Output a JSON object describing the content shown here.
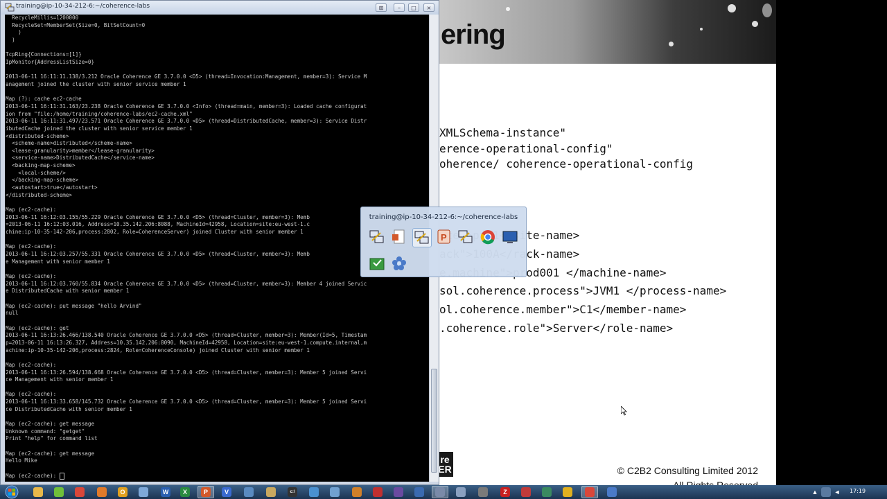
{
  "slide": {
    "title_fragment": "ering",
    "xml_lines": [
      "XMLSchema-instance\"",
      "erence-operational-config\"",
      "oherence/ coherence-operational-config",
      "ite\">pa-1</site-name>",
      "ack\">100A</rack-name>",
      "e.machine\">prod001 </machine-name>",
      "sol.coherence.process\">JVM1 </process-name>",
      "ol.coherence.member\">C1</member-name>",
      ".coherence.role\">Server</role-name>"
    ],
    "logo_text": "re\nER",
    "copyright_line1": "© C2B2 Consulting Limited 2012",
    "copyright_line2": "All Rights Reserved"
  },
  "putty": {
    "title": "training@ip-10-34-212-6:~/coherence-labs",
    "buttons": {
      "extra": "⊞",
      "minimize": "–",
      "maximize": "□",
      "close": "×"
    },
    "terminal_lines": [
      "  RecycleMillis=1200000",
      "  RecycleSet=MemberSet(Size=0, BitSetCount=0",
      "    )",
      "  )",
      "",
      "TcpRing{Connections=[1]}",
      "IpMonitor{AddressListSize=0}",
      "",
      "2013-06-11 16:11:11.138/3.212 Oracle Coherence GE 3.7.0.0 <D5> (thread=Invocation:Management, member=3): Service M",
      "anagement joined the cluster with senior service member 1",
      "",
      "Map (?): cache ec2-cache",
      "2013-06-11 16:11:31.163/23.238 Oracle Coherence GE 3.7.0.0 <Info> (thread=main, member=3): Loaded cache configurat",
      "ion from \"file:/home/training/coherence-labs/ec2-cache.xml\"",
      "2013-06-11 16:11:31.497/23.571 Oracle Coherence GE 3.7.0.0 <D5> (thread=DistributedCache, member=3): Service Distr",
      "ibutedCache joined the cluster with senior service member 1",
      "<distributed-scheme>",
      "  <scheme-name>distributed</scheme-name>",
      "  <lease-granularity>member</lease-granularity>",
      "  <service-name>DistributedCache</service-name>",
      "  <backing-map-scheme>",
      "    <local-scheme/>",
      "  </backing-map-scheme>",
      "  <autostart>true</autostart>",
      "</distributed-scheme>",
      "",
      "Map (ec2-cache):",
      "2013-06-11 16:12:03.155/55.229 Oracle Coherence GE 3.7.0.0 <D5> (thread=Cluster, member=3): Memb",
      "=2013-06-11 16:12:03.016, Address=10.35.142.206:8088, MachineId=42958, Location=site:eu-west-1.c",
      "chine:ip-10-35-142-206,process:2802, Role=CoherenceServer) joined Cluster with senior member 1",
      "",
      "Map (ec2-cache):",
      "2013-06-11 16:12:03.257/55.331 Oracle Coherence GE 3.7.0.0 <D5> (thread=Cluster, member=3): Memb",
      "e Management with senior member 1",
      "",
      "Map (ec2-cache):",
      "2013-06-11 16:12:03.760/55.834 Oracle Coherence GE 3.7.0.0 <D5> (thread=Cluster, member=3): Member 4 joined Servic",
      "e DistributedCache with senior member 1",
      "",
      "Map (ec2-cache): put message \"hello Arvind\"",
      "null",
      "",
      "Map (ec2-cache): get",
      "2013-06-11 16:13:26.466/138.540 Oracle Coherence GE 3.7.0.0 <D5> (thread=Cluster, member=3): Member(Id=5, Timestam",
      "p=2013-06-11 16:13:26.327, Address=10.35.142.206:8090, MachineId=42958, Location=site:eu-west-1.compute.internal,m",
      "achine:ip-10-35-142-206,process:2824, Role=CoherenceConsole) joined Cluster with senior member 1",
      "",
      "Map (ec2-cache):",
      "2013-06-11 16:13:26.594/138.668 Oracle Coherence GE 3.7.0.0 <D5> (thread=Cluster, member=3): Member 5 joined Servi",
      "ce Management with senior member 1",
      "",
      "Map (ec2-cache):",
      "2013-06-11 16:13:33.658/145.732 Oracle Coherence GE 3.7.0.0 <D5> (thread=Cluster, member=3): Member 5 joined Servi",
      "ce DistributedCache with senior member 1",
      "",
      "Map (ec2-cache): get message",
      "Unknown command: \"getget\"",
      "Print \"help\" for command list",
      "",
      "Map (ec2-cache): get message",
      "Hello Mike",
      "",
      "Map (ec2-cache): "
    ]
  },
  "popup": {
    "title": "training@ip-10-34-212-6:~/coherence-labs",
    "icons": [
      "putty-icon",
      "document-icon",
      "putty-icon",
      "powerpoint-icon",
      "putty-icon",
      "chrome-icon",
      "remote-desktop-icon",
      "download-icon",
      "flower-icon"
    ]
  },
  "taskbar": {
    "clock": "17:19",
    "icons": [
      {
        "name": "explorer-icon",
        "glyph": "",
        "color": "#e8b84a"
      },
      {
        "name": "green-app-icon",
        "glyph": "",
        "color": "#6fbf3a"
      },
      {
        "name": "chrome-icon",
        "glyph": "",
        "color": "#d9473a"
      },
      {
        "name": "firefox-icon",
        "glyph": "",
        "color": "#e07a2a"
      },
      {
        "name": "outlook-icon",
        "glyph": "O",
        "color": "#e0a020"
      },
      {
        "name": "notes-icon",
        "glyph": "",
        "color": "#7ea8d8"
      },
      {
        "name": "word-icon",
        "glyph": "W",
        "color": "#2a5fb0"
      },
      {
        "name": "excel-icon",
        "glyph": "X",
        "color": "#2a8a40"
      },
      {
        "name": "powerpoint-icon",
        "glyph": "P",
        "color": "#d2582a"
      },
      {
        "name": "visio-icon",
        "glyph": "V",
        "color": "#3a6ad0"
      },
      {
        "name": "network-icon",
        "glyph": "",
        "color": "#5a8ac0"
      },
      {
        "name": "folder-icon",
        "glyph": "",
        "color": "#c8a860"
      },
      {
        "name": "console-icon",
        "glyph": "c:\\",
        "color": "#333333"
      },
      {
        "name": "tool-icon",
        "glyph": "",
        "color": "#4a90d0"
      },
      {
        "name": "network2-icon",
        "glyph": "",
        "color": "#70a0d0"
      },
      {
        "name": "java-icon",
        "glyph": "",
        "color": "#d0802a"
      },
      {
        "name": "bug-icon",
        "glyph": "",
        "color": "#c03030"
      },
      {
        "name": "eclipse-icon",
        "glyph": "",
        "color": "#6a4aa0"
      },
      {
        "name": "shield-icon",
        "glyph": "",
        "color": "#3a6ab0"
      },
      {
        "name": "putty-icon",
        "glyph": "",
        "color": "#7a8aa8"
      },
      {
        "name": "arrow-icon",
        "glyph": "",
        "color": "#8aa0c0"
      },
      {
        "name": "tools-icon",
        "glyph": "",
        "color": "#7a7a7a"
      },
      {
        "name": "filezilla-icon",
        "glyph": "Z",
        "color": "#c82020"
      },
      {
        "name": "chart-icon",
        "glyph": "",
        "color": "#c03a3a"
      },
      {
        "name": "network3-icon",
        "glyph": "",
        "color": "#3a8a60"
      },
      {
        "name": "sun-icon",
        "glyph": "",
        "color": "#e0b020"
      },
      {
        "name": "chrome2-icon",
        "glyph": "",
        "color": "#d9473a"
      },
      {
        "name": "flower-icon",
        "glyph": "",
        "color": "#4a7ac8"
      }
    ]
  }
}
